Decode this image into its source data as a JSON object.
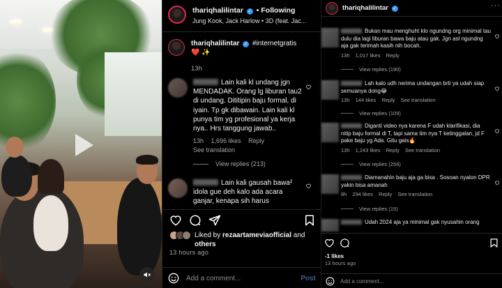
{
  "post": {
    "username": "thariqhalilintar",
    "follow_status": "Following",
    "audio": "Jung Kook, Jack Harlow • 3D (feat. Jac...",
    "caption_text": "#internetgratis",
    "caption_emoji": "❤️ ✨",
    "caption_time": "13h",
    "comments": [
      {
        "text": "Lain kali kl undang jgn MENDADAK. Orang lg liburan tau2 di undang. Dititipin baju formal, di iyain. Tp gk dibawain. Lain kali kl punya tim yg profesional ya kerja nya.. Hrs tanggung jawab..",
        "time": "13h",
        "likes": "1,696 likes",
        "reply": "Reply",
        "translate": "See translation",
        "view_replies": "View replies (213)"
      },
      {
        "text": "Lain kali gausah bawa² idola gue deh kalo ada acara ganjar, kenapa sih harus"
      }
    ],
    "liked_by_prefix": "Liked by",
    "liked_by_user": "rezaartameviaofficial",
    "liked_by_and": "and",
    "liked_by_others": "others",
    "post_time": "13 hours ago",
    "add_comment_placeholder": "Add a comment...",
    "post_button": "Post"
  },
  "right_panel": {
    "username": "thariqhalilintar",
    "comments": [
      {
        "text": "Bukan mau menghuht klo ngundng org minimal tau dulu dia lagi liburan bawa baju atau gak. Jgn asl ngundng aja gak terimah kasih nih bocah.",
        "time": "13h",
        "likes": "1,017 likes",
        "reply": "Reply",
        "view_replies": "View replies (190)"
      },
      {
        "text": "Lah kalo udh nerima undangan brti ya udah siap semuanya dong😂",
        "time": "13h",
        "likes": "144 likes",
        "reply": "Reply",
        "translate": "See translation",
        "view_replies": "View replies (109)"
      },
      {
        "text": "Diganti video nya karena F udah klarifikasi, dia nitip baju formal di T, tapi sama tim nya T ketinggalan, jd F pake baju yg Ada. Gitu gais🔥",
        "time": "13h",
        "likes": "1,243 likes",
        "reply": "Reply",
        "translate": "See translation",
        "view_replies": "View replies (256)"
      },
      {
        "text": "Diamanahin baju aja ga bisa . Sosoan nyalon DPR yakin bisa amanah",
        "time": "8h",
        "likes": "294 likes",
        "reply": "Reply",
        "translate": "See translation",
        "view_replies": "View replies (15)"
      },
      {
        "text": "Udah 2024 aja ya minimal gak nyusahin orang"
      }
    ],
    "likes": "-1 likes",
    "time": "13 hours ago",
    "add_comment_placeholder": "Add a comment..."
  }
}
